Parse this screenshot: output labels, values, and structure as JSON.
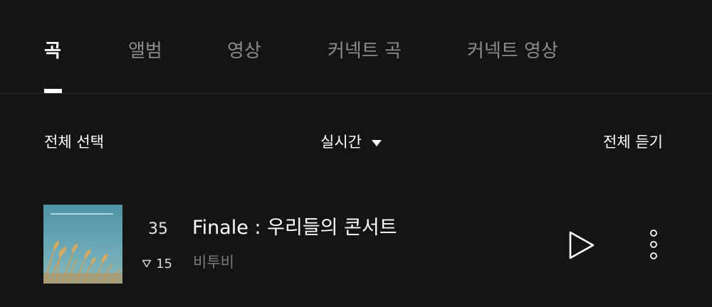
{
  "tabs": [
    {
      "label": "곡",
      "active": true
    },
    {
      "label": "앨범",
      "active": false
    },
    {
      "label": "영상",
      "active": false
    },
    {
      "label": "커넥트 곡",
      "active": false
    },
    {
      "label": "커넥트 영상",
      "active": false
    }
  ],
  "toolbar": {
    "select_all": "전체 선택",
    "sort_label": "실시간",
    "play_all": "전체 듣기"
  },
  "songs": [
    {
      "rank": "35",
      "rank_change": "15",
      "rank_direction": "down",
      "title": "Finale : 우리들의 콘서트",
      "artist": "비투비"
    }
  ],
  "colors": {
    "background": "#141414",
    "active_text": "#ffffff",
    "inactive_text": "#8a8a8a",
    "secondary_text": "#7a7a7a",
    "divider": "#2e2e2e"
  },
  "icons": {
    "sort": "caret-down-icon",
    "rank_change": "triangle-down-outline-icon",
    "play": "play-outline-icon",
    "more": "more-vertical-dots-icon"
  }
}
